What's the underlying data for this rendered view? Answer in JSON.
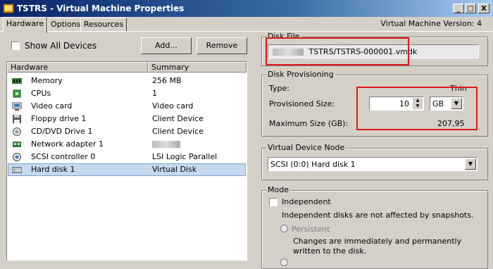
{
  "window": {
    "title": "TSTRS - Virtual Machine Properties",
    "min_label": "_",
    "max_label": "□",
    "close_label": "X"
  },
  "tabs": [
    {
      "label": "Hardware",
      "active": true
    },
    {
      "label": "Options",
      "active": false
    },
    {
      "label": "Resources",
      "active": false
    }
  ],
  "vm_version": "Virtual Machine Version: 4",
  "left": {
    "show_all_devices_label": "Show All Devices",
    "show_all_devices_checked": false,
    "add_label": "Add...",
    "remove_label": "Remove",
    "col_hardware": "Hardware",
    "col_summary": "Summary",
    "devices": [
      {
        "name": "Memory",
        "summary": "256 MB",
        "icon": "memory-icon"
      },
      {
        "name": "CPUs",
        "summary": "1",
        "icon": "cpu-icon"
      },
      {
        "name": "Video card",
        "summary": "Video card",
        "icon": "video-card-icon"
      },
      {
        "name": "Floppy drive 1",
        "summary": "Client Device",
        "icon": "floppy-icon"
      },
      {
        "name": "CD/DVD Drive 1",
        "summary": "Client Device",
        "icon": "cd-dvd-icon"
      },
      {
        "name": "Network adapter 1",
        "summary": "",
        "icon": "network-icon"
      },
      {
        "name": "SCSI controller 0",
        "summary": "LSI Logic Parallel",
        "icon": "scsi-icon"
      },
      {
        "name": "Hard disk 1",
        "summary": "Virtual Disk",
        "icon": "hard-disk-icon",
        "selected": true
      }
    ]
  },
  "right": {
    "disk_file": {
      "label": "Disk File",
      "path": "TSTRS/TSTRS-000001.vmdk"
    },
    "provisioning": {
      "label": "Disk Provisioning",
      "type_label": "Type:",
      "type_value": "Thin",
      "size_label": "Provisioned Size:",
      "size_value": "10",
      "unit_value": "GB",
      "max_label": "Maximum Size (GB):",
      "max_value": "207,95"
    },
    "vdn": {
      "label": "Virtual Device Node",
      "value": "SCSI (0:0) Hard disk 1"
    },
    "mode": {
      "label": "Mode",
      "independent_label": "Independent",
      "independent_checked": false,
      "independent_desc": "Independent disks are not affected by snapshots.",
      "persistent_label": "Persistent",
      "persistent_desc": "Changes are immediately and permanently written to the disk."
    }
  }
}
